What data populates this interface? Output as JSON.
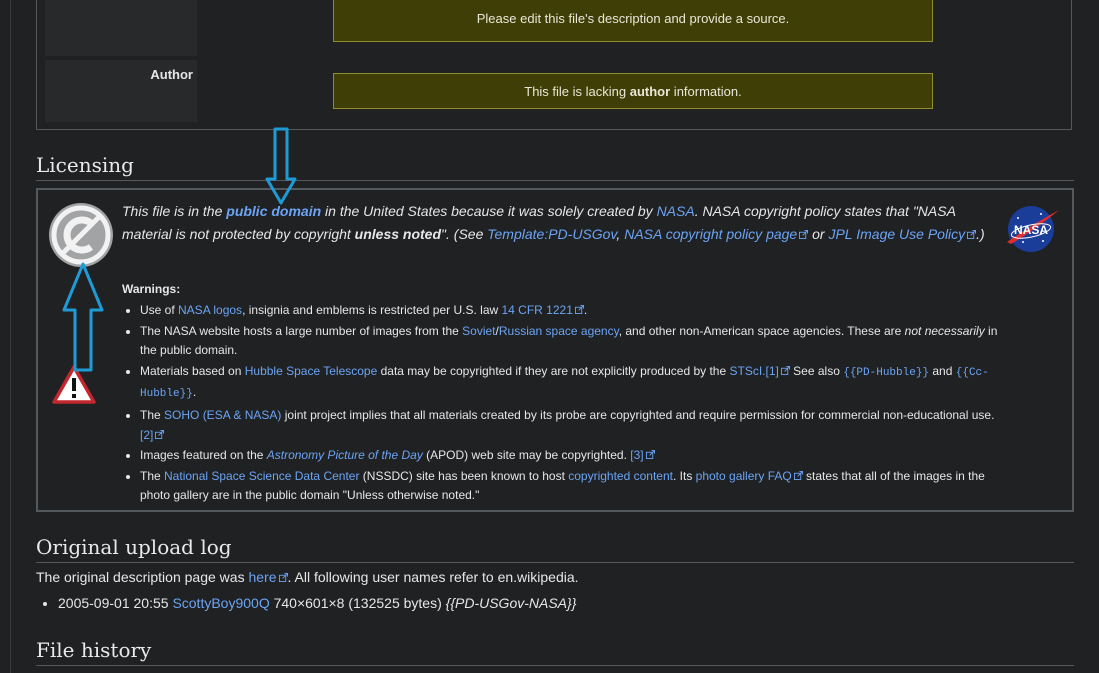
{
  "file_info": {
    "author_label": "Author",
    "description_notice": "Please edit this file's description and provide a source.",
    "author_notice_pre": "This file is lacking ",
    "author_notice_bold": "author",
    "author_notice_post": " information."
  },
  "licensing": {
    "heading": "Licensing",
    "text": {
      "t1": "This file is in the ",
      "public_domain": "public domain",
      "t2": " in the United States because it was solely created by ",
      "nasa": "NASA",
      "t3": ". NASA copyright policy states that \"NASA material is not protected by copyright ",
      "unless_noted": "unless noted",
      "t4": "\". (See ",
      "template_link": "Template:PD-USGov",
      "t5": ", ",
      "policy_link": "NASA copyright policy page",
      "t6": " or ",
      "jpl_link": "JPL Image Use Policy",
      "t7": ".)"
    },
    "warnings_title": "Warnings:",
    "warnings": {
      "w1": {
        "a": "Use of ",
        "l1": "NASA logos",
        "b": ", insignia and emblems is restricted per U.S. law ",
        "l2": "14 CFR 1221",
        "c": "."
      },
      "w2": {
        "a": "The NASA website hosts a large number of images from the ",
        "l1": "Soviet",
        "s": "/",
        "l2": "Russian space agency",
        "b": ", and other non-American space agencies. These are ",
        "em": "not necessarily",
        "c": " in the public domain."
      },
      "w3": {
        "a": "Materials based on ",
        "l1": "Hubble Space Telescope",
        "b": " data may be copyrighted if they are not explicitly produced by the ",
        "l2": "STScI",
        "l3": ".[1]",
        "c": " See also ",
        "m1": "{{PD-Hubble}}",
        "d": " and ",
        "m2": "{{Cc-Hubble}}",
        "e": "."
      },
      "w4": {
        "a": "The ",
        "l1": "SOHO (ESA & NASA)",
        "b": " joint project implies that all materials created by its probe are copyrighted and require permission for commercial non-educational use. ",
        "l2": "[2]"
      },
      "w5": {
        "a": "Images featured on the ",
        "l1": "Astronomy Picture of the Day",
        "b": " (APOD) web site may be copyrighted. ",
        "l2": "[3]"
      },
      "w6": {
        "a": "The ",
        "l1": "National Space Science Data Center",
        "b": " (NSSDC) site has been known to host ",
        "l2": "copyrighted content",
        "c": ". Its ",
        "l3": "photo gallery FAQ",
        "d": " states that all of the images in the photo gallery are in the public domain \"Unless otherwise noted.\""
      }
    },
    "nasa_logo_text": "NASA"
  },
  "upload_log": {
    "heading": "Original upload log",
    "intro_pre": "The original description page was ",
    "intro_link": "here",
    "intro_post": ". All following user names refer to en.wikipedia.",
    "entry": {
      "datetime": "2005-09-01 20:55",
      "user": "ScottyBoy900Q",
      "details": " 740×601×8 (132525 bytes) ",
      "summary": "{{PD-USGov-NASA}}"
    }
  },
  "file_history": {
    "heading": "File history"
  },
  "colors": {
    "link": "#6ba4f5",
    "notice_bg": "#3e3e06",
    "annotation_arrow": "#1e9bd7"
  }
}
